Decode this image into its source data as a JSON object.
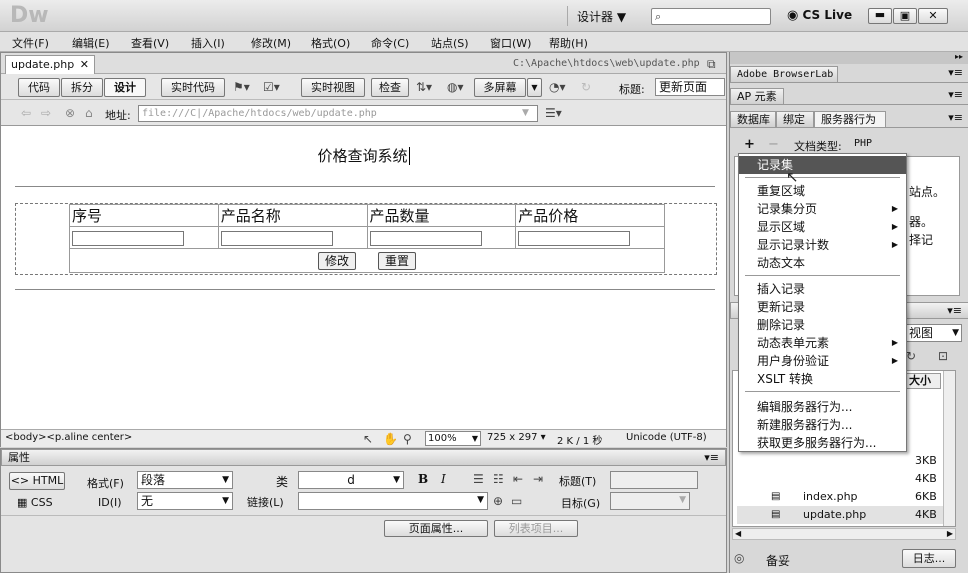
{
  "app": {
    "logo": "Dw",
    "workspace": "设计器",
    "search_placeholder": "",
    "cslive": "CS Live"
  },
  "menu": [
    "文件(F)",
    "编辑(E)",
    "查看(V)",
    "插入(I)",
    "修改(M)",
    "格式(O)",
    "命令(C)",
    "站点(S)",
    "窗口(W)",
    "帮助(H)"
  ],
  "doc": {
    "tab": "update.php",
    "path": "C:\\Apache\\htdocs\\web\\update.php",
    "views": [
      "代码",
      "拆分",
      "设计"
    ],
    "live_code": "实时代码",
    "live_view": "实时视图",
    "inspect": "检查",
    "multiscreen": "多屏幕",
    "title_label": "标题:",
    "title_value": "更新页面",
    "address_label": "地址:",
    "address": "file:///C|/Apache/htdocs/web/update.php",
    "heading": "价格查询系统",
    "columns": [
      "序号",
      "产品名称",
      "产品数量",
      "产品价格"
    ],
    "buttons": {
      "submit": "修改",
      "reset": "重置"
    },
    "tagpath": "<body><p.aline center>",
    "zoom": "100%",
    "size": "725 x 297",
    "weight": "2 K / 1 秒",
    "encoding": "Unicode (UTF-8)"
  },
  "props": {
    "title": "属性",
    "html": "HTML",
    "css": "CSS",
    "format_label": "格式(F)",
    "format_value": "段落",
    "class_label": "类",
    "class_value": "d",
    "id_label": "ID(I)",
    "id_value": "无",
    "link_label": "链接(L)",
    "heading_label": "标题(T)",
    "target_label": "目标(G)",
    "page_props": "页面属性...",
    "list_item": "列表项目..."
  },
  "panels": {
    "browserlab": "Adobe BrowserLab",
    "ap": "AP 元素",
    "tabs": [
      "数据库",
      "绑定",
      "服务器行为"
    ],
    "doctype_label": "文档类型:",
    "doctype": "PHP",
    "plus": "+",
    "minus": "−",
    "bg_text": [
      "站点。",
      "器。",
      "择记"
    ],
    "view_label": "视图",
    "size_header": "大小",
    "files": [
      {
        "name": "",
        "size": "3KB"
      },
      {
        "name": "",
        "size": "4KB"
      },
      {
        "name": "index.php",
        "size": "6KB"
      },
      {
        "name": "update.php",
        "size": "4KB"
      }
    ],
    "status": "备妥",
    "log": "日志..."
  },
  "context_menu": {
    "items": [
      {
        "label": "记录集",
        "hl": true
      },
      {
        "label": "重复区域"
      },
      {
        "label": "记录集分页",
        "sub": true
      },
      {
        "label": "显示区域",
        "sub": true
      },
      {
        "label": "显示记录计数",
        "sub": true
      },
      {
        "label": "动态文本"
      },
      {
        "label": "插入记录"
      },
      {
        "label": "更新记录"
      },
      {
        "label": "删除记录"
      },
      {
        "label": "动态表单元素",
        "sub": true
      },
      {
        "label": "用户身份验证",
        "sub": true
      },
      {
        "label": "XSLT 转换"
      },
      {
        "label": "编辑服务器行为..."
      },
      {
        "label": "新建服务器行为..."
      },
      {
        "label": "获取更多服务器行为..."
      }
    ]
  }
}
